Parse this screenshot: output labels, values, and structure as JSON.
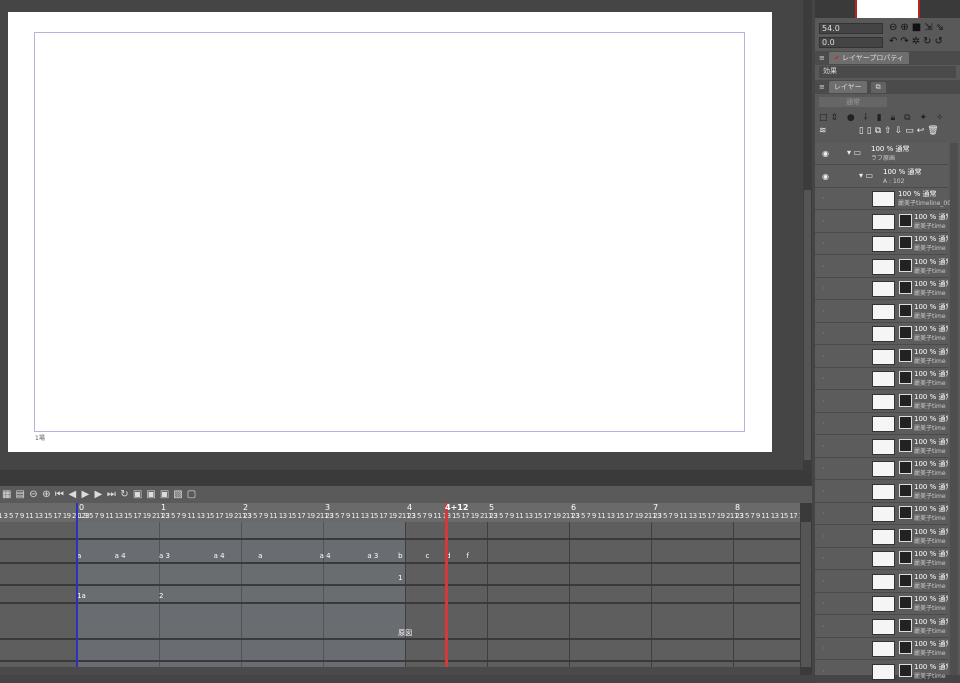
{
  "canvas": {
    "label": "1場"
  },
  "timeline": {
    "toolbar_icons": [
      "new-timeline-icon",
      "timeline-settings-icon",
      "zoom-out-icon",
      "zoom-in-icon",
      "first-frame-icon",
      "prev-frame-icon",
      "play-icon",
      "next-frame-icon",
      "last-frame-icon",
      "loop-icon",
      "new-cel-icon",
      "specify-cel-icon",
      "onion-skin-icon",
      "light-table-icon",
      "enable-icon"
    ],
    "fps": 24,
    "seconds": [
      "0",
      "1",
      "2",
      "3",
      "4",
      "5",
      "6",
      "7",
      "8"
    ],
    "subticks": "1 3 5 7 9 11 13 15 17 19 21 23",
    "playhead_label": "4+12",
    "playhead_frame": 108,
    "tracks": [
      {
        "cels": []
      },
      {
        "cels": [
          {
            "label": "a",
            "frame": 1
          },
          {
            "label": "a 4",
            "frame": 12
          },
          {
            "label": "a 3",
            "frame": 25
          },
          {
            "label": "a 4",
            "frame": 41
          },
          {
            "label": "a",
            "frame": 54
          },
          {
            "label": "a 4",
            "frame": 72
          },
          {
            "label": "a 3",
            "frame": 86
          },
          {
            "label": "b",
            "frame": 95
          },
          {
            "label": "c",
            "frame": 103
          },
          {
            "label": "d",
            "frame": 109
          },
          {
            "label": "f",
            "frame": 115
          }
        ]
      },
      {
        "cels": [
          {
            "label": "1",
            "frame": 95
          }
        ]
      },
      {
        "cels": [
          {
            "label": "1a",
            "frame": 1
          },
          {
            "label": "2",
            "frame": 25
          }
        ]
      },
      {
        "cels": [
          {
            "label": "原図",
            "frame": 95
          }
        ]
      },
      {
        "cels": []
      }
    ]
  },
  "right_panel": {
    "zoom_value": "54.0",
    "rotate_value": "0.0",
    "tab_layer_property": "レイヤープロパティ",
    "effect_label": "効果",
    "tab_layer": "レイヤー",
    "blend_mode": "通常",
    "layers": [
      {
        "title": "100 % 通常",
        "sub": "ラフ原画",
        "type": "folder",
        "visible": true
      },
      {
        "title": "100 % 通常",
        "sub": "A : 102",
        "type": "animation-folder",
        "visible": true
      },
      {
        "title": "100 % 通常",
        "sub": "麗美子timeline_00",
        "type": "raster",
        "visible": false
      },
      {
        "title": "100 % 通常",
        "sub": "麗美子time",
        "type": "raster-mask",
        "visible": false
      },
      {
        "title": "100 % 通常",
        "sub": "麗美子time",
        "type": "raster-mask",
        "visible": false
      },
      {
        "title": "100 % 通常",
        "sub": "麗美子time",
        "type": "raster-mask",
        "visible": false
      },
      {
        "title": "100 % 通常",
        "sub": "麗美子time",
        "type": "raster-mask",
        "visible": false
      },
      {
        "title": "100 % 通常",
        "sub": "麗美子time",
        "type": "raster-mask",
        "visible": false
      },
      {
        "title": "100 % 通常",
        "sub": "麗美子time",
        "type": "raster-mask",
        "visible": false
      },
      {
        "title": "100 % 通常",
        "sub": "麗美子time",
        "type": "raster-mask",
        "visible": false
      },
      {
        "title": "100 % 通常",
        "sub": "麗美子time",
        "type": "raster-mask",
        "visible": false
      },
      {
        "title": "100 % 通常",
        "sub": "麗美子time",
        "type": "raster-mask",
        "visible": false
      },
      {
        "title": "100 % 通常",
        "sub": "麗美子time",
        "type": "raster-mask",
        "visible": false
      },
      {
        "title": "100 % 通常",
        "sub": "麗美子time",
        "type": "raster-mask",
        "visible": false
      },
      {
        "title": "100 % 通常",
        "sub": "麗美子time",
        "type": "raster-mask",
        "visible": false
      },
      {
        "title": "100 % 通常",
        "sub": "麗美子time",
        "type": "raster-mask",
        "visible": false
      },
      {
        "title": "100 % 通常",
        "sub": "麗美子time",
        "type": "raster-mask",
        "visible": false
      },
      {
        "title": "100 % 通常",
        "sub": "麗美子time",
        "type": "raster-mask",
        "visible": false
      },
      {
        "title": "100 % 通常",
        "sub": "麗美子time",
        "type": "raster-mask",
        "visible": false
      },
      {
        "title": "100 % 通常",
        "sub": "麗美子time",
        "type": "raster-mask",
        "visible": false
      },
      {
        "title": "100 % 通常",
        "sub": "麗美子time",
        "type": "raster-mask",
        "visible": false
      },
      {
        "title": "100 % 通常",
        "sub": "麗美子time",
        "type": "raster-mask",
        "visible": false
      },
      {
        "title": "100 % 通常",
        "sub": "麗美子time",
        "type": "raster-mask",
        "visible": false
      },
      {
        "title": "100 % 通常",
        "sub": "麗美子time",
        "type": "raster-mask",
        "visible": false
      }
    ]
  }
}
